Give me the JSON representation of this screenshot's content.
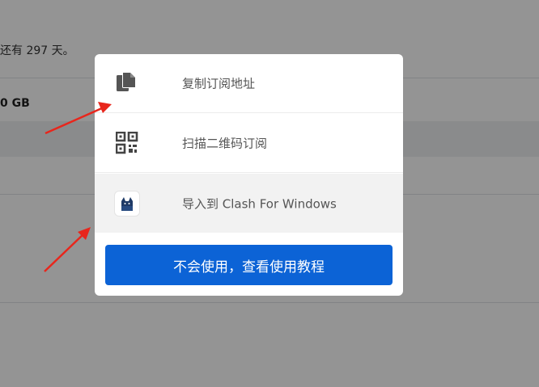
{
  "background": {
    "days_text": "还有 297 天。",
    "traffic_text": "0 GB"
  },
  "modal": {
    "items": [
      {
        "label": "复制订阅地址",
        "icon": "copy-icon"
      },
      {
        "label": "扫描二维码订阅",
        "icon": "qr-code-icon"
      },
      {
        "label": "导入到 Clash For Windows",
        "icon": "clash-cat-icon"
      }
    ],
    "help_button_label": "不会使用，查看使用教程"
  },
  "colors": {
    "primary": "#0c63d6",
    "annotation_arrow": "#e8261c",
    "overlay": "rgba(0,0,0,0.42)"
  }
}
